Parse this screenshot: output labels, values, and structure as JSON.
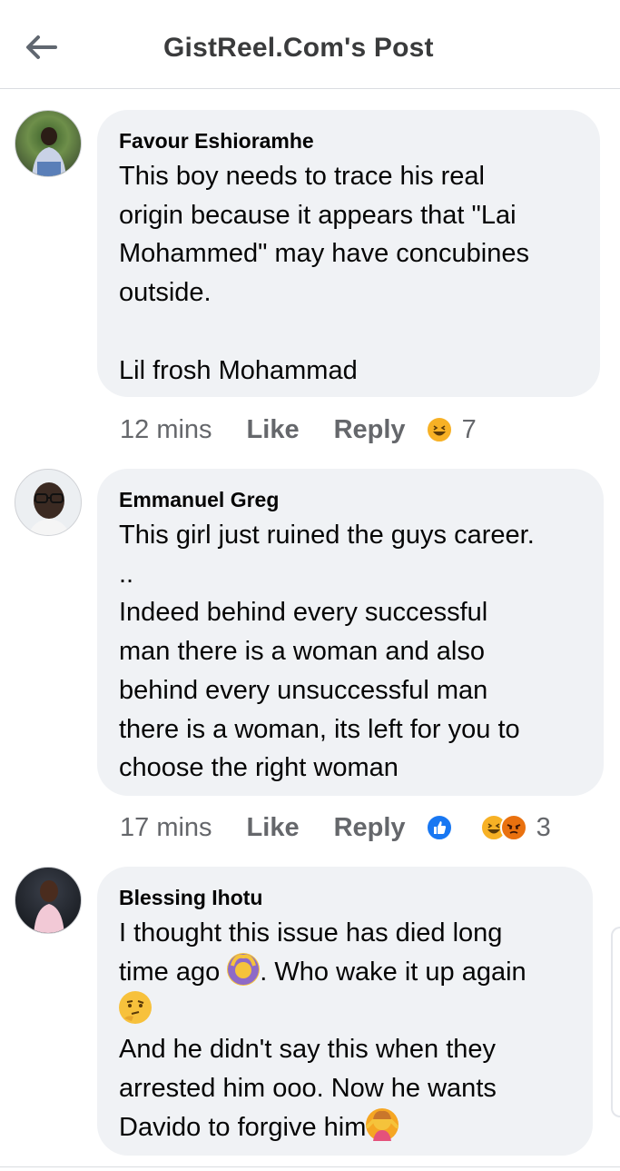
{
  "header": {
    "title": "GistReel.Com's Post",
    "back_icon": "back-arrow-icon"
  },
  "comments": [
    {
      "author": "Favour Eshioramhe",
      "text": "This boy needs to trace his real\norigin because it appears that \"Lai\nMohammed\" may have concubines\noutside.\n\nLil frosh Mohammad",
      "time": "12 mins",
      "like": "Like",
      "reply": "Reply",
      "reactions": [
        "haha"
      ],
      "reaction_count": "7"
    },
    {
      "author": "Emmanuel Greg",
      "text": "This girl just ruined the guys career.\n..\nIndeed behind every successful\nman there is a woman and also\nbehind every unsuccessful man\nthere is a woman, its left for you to\nchoose the right woman",
      "time": "17 mins",
      "like": "Like",
      "reply": "Reply",
      "reactions": [
        "like",
        "haha",
        "angry"
      ],
      "reaction_count": "3"
    },
    {
      "author": "Blessing Ihotu",
      "text_line1": "I thought this issue has died long",
      "text_line2a": "time ago ",
      "text_line2b": ". Who wake it up again",
      "text_line4": "And he didn't say this when they",
      "text_line5": "arrested him ooo. Now he wants",
      "text_line6": "Davido to forgive him"
    }
  ],
  "colors": {
    "bubble": "#f0f2f5",
    "meta_text": "#65676b",
    "like_blue": "#1877f2",
    "haha_yellow": "#f7b125",
    "angry_orange": "#e9710f"
  }
}
